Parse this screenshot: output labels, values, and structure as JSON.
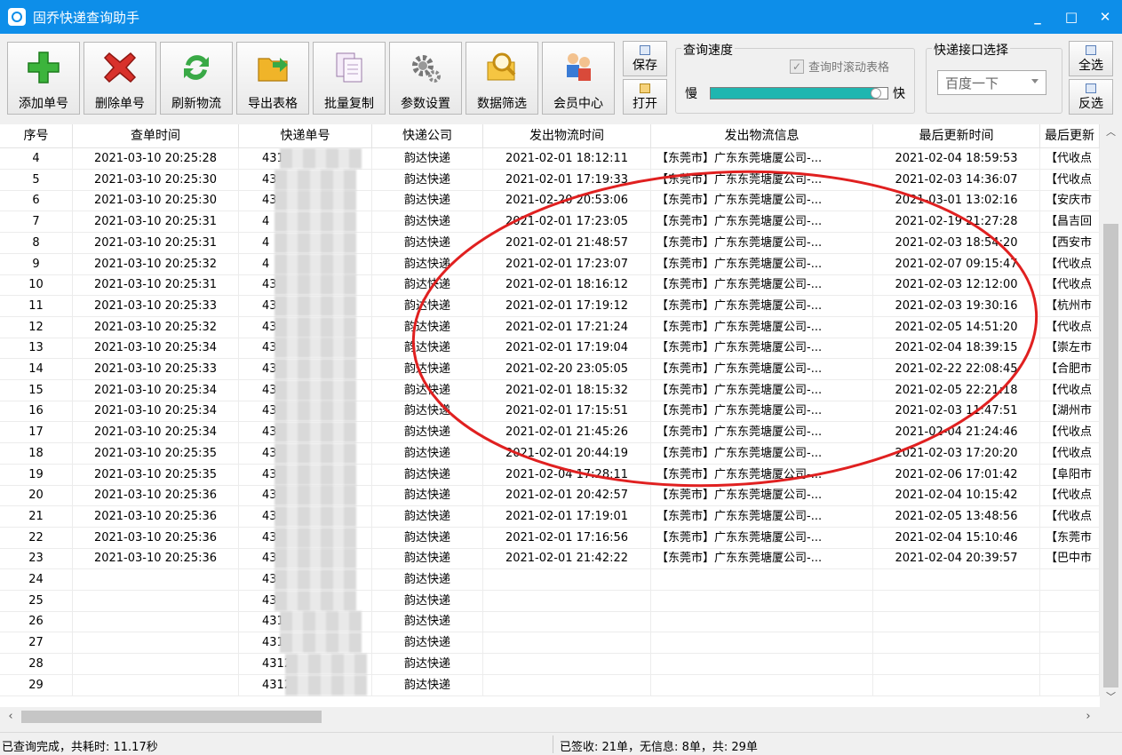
{
  "window": {
    "title": "固乔快递查询助手",
    "minimize": "_",
    "maximize": "□",
    "close": "✕"
  },
  "toolbar": {
    "buttons": [
      {
        "label": "添加单号",
        "icon": "add-icon"
      },
      {
        "label": "删除单号",
        "icon": "delete-icon"
      },
      {
        "label": "刷新物流",
        "icon": "refresh-icon"
      },
      {
        "label": "导出表格",
        "icon": "export-folder-icon"
      },
      {
        "label": "批量复制",
        "icon": "copy-icon"
      },
      {
        "label": "参数设置",
        "icon": "gear-icon"
      },
      {
        "label": "数据筛选",
        "icon": "search-icon"
      },
      {
        "label": "会员中心",
        "icon": "members-icon"
      }
    ],
    "save_label": "保存",
    "open_label": "打开",
    "speed_group_title": "查询速度",
    "scroll_table_label": "查询时滚动表格",
    "slow_label": "慢",
    "fast_label": "快",
    "speed_level": 0.94,
    "api_group_title": "快递接口选择",
    "api_selected": "百度一下",
    "select_all_label": "全选",
    "invert_label": "反选"
  },
  "table": {
    "columns": [
      "序号",
      "查单时间",
      "快递单号",
      "快递公司",
      "发出物流时间",
      "发出物流信息",
      "最后更新时间",
      "最后更新"
    ],
    "rows": [
      [
        "4",
        "2021-03-10 20:25:28",
        "43122",
        "韵达快递",
        "2021-02-01 18:12:11",
        "【东莞市】广东东莞塘厦公司-...",
        "2021-02-04 18:59:53",
        "【代收点"
      ],
      [
        "5",
        "2021-03-10 20:25:30",
        "4312",
        "韵达快递",
        "2021-02-01 17:19:33",
        "【东莞市】广东东莞塘厦公司-...",
        "2021-02-03 14:36:07",
        "【代收点"
      ],
      [
        "6",
        "2021-03-10 20:25:30",
        "43",
        "韵达快递",
        "2021-02-20 20:53:06",
        "【东莞市】广东东莞塘厦公司-...",
        "2021-03-01 13:02:16",
        "【安庆市"
      ],
      [
        "7",
        "2021-03-10 20:25:31",
        "4",
        "韵达快递",
        "2021-02-01 17:23:05",
        "【东莞市】广东东莞塘厦公司-...",
        "2021-02-19 21:27:28",
        "【昌吉回"
      ],
      [
        "8",
        "2021-03-10 20:25:31",
        "4",
        "韵达快递",
        "2021-02-01 21:48:57",
        "【东莞市】广东东莞塘厦公司-...",
        "2021-02-03 18:54:20",
        "【西安市"
      ],
      [
        "9",
        "2021-03-10 20:25:32",
        "4",
        "韵达快递",
        "2021-02-01 17:23:07",
        "【东莞市】广东东莞塘厦公司-...",
        "2021-02-07 09:15:47",
        "【代收点"
      ],
      [
        "10",
        "2021-03-10 20:25:31",
        "43",
        "韵达快递",
        "2021-02-01 18:16:12",
        "【东莞市】广东东莞塘厦公司-...",
        "2021-02-03 12:12:00",
        "【代收点"
      ],
      [
        "11",
        "2021-03-10 20:25:33",
        "43",
        "韵达快递",
        "2021-02-01 17:19:12",
        "【东莞市】广东东莞塘厦公司-...",
        "2021-02-03 19:30:16",
        "【杭州市"
      ],
      [
        "12",
        "2021-03-10 20:25:32",
        "431",
        "韵达快递",
        "2021-02-01 17:21:24",
        "【东莞市】广东东莞塘厦公司-...",
        "2021-02-05 14:51:20",
        "【代收点"
      ],
      [
        "13",
        "2021-03-10 20:25:34",
        "431",
        "韵达快递",
        "2021-02-01 17:19:04",
        "【东莞市】广东东莞塘厦公司-...",
        "2021-02-04 18:39:15",
        "【崇左市"
      ],
      [
        "14",
        "2021-03-10 20:25:33",
        "431",
        "韵达快递",
        "2021-02-20 23:05:05",
        "【东莞市】广东东莞塘厦公司-...",
        "2021-02-22 22:08:45",
        "【合肥市"
      ],
      [
        "15",
        "2021-03-10 20:25:34",
        "431",
        "韵达快递",
        "2021-02-01 18:15:32",
        "【东莞市】广东东莞塘厦公司-...",
        "2021-02-05 22:21:18",
        "【代收点"
      ],
      [
        "16",
        "2021-03-10 20:25:34",
        "431",
        "韵达快递",
        "2021-02-01 17:15:51",
        "【东莞市】广东东莞塘厦公司-...",
        "2021-02-03 11:47:51",
        "【湖州市"
      ],
      [
        "17",
        "2021-03-10 20:25:34",
        "431",
        "韵达快递",
        "2021-02-01 21:45:26",
        "【东莞市】广东东莞塘厦公司-...",
        "2021-02-04 21:24:46",
        "【代收点"
      ],
      [
        "18",
        "2021-03-10 20:25:35",
        "431",
        "韵达快递",
        "2021-02-01 20:44:19",
        "【东莞市】广东东莞塘厦公司-...",
        "2021-02-03 17:20:20",
        "【代收点"
      ],
      [
        "19",
        "2021-03-10 20:25:35",
        "431",
        "韵达快递",
        "2021-02-04 17:28:11",
        "【东莞市】广东东莞塘厦公司-...",
        "2021-02-06 17:01:42",
        "【阜阳市"
      ],
      [
        "20",
        "2021-03-10 20:25:36",
        "4312",
        "韵达快递",
        "2021-02-01 20:42:57",
        "【东莞市】广东东莞塘厦公司-...",
        "2021-02-04 10:15:42",
        "【代收点"
      ],
      [
        "21",
        "2021-03-10 20:25:36",
        "4312",
        "韵达快递",
        "2021-02-01 17:19:01",
        "【东莞市】广东东莞塘厦公司-...",
        "2021-02-05 13:48:56",
        "【代收点"
      ],
      [
        "22",
        "2021-03-10 20:25:36",
        "431",
        "韵达快递",
        "2021-02-01 17:16:56",
        "【东莞市】广东东莞塘厦公司-...",
        "2021-02-04 15:10:46",
        "【东莞市"
      ],
      [
        "23",
        "2021-03-10 20:25:36",
        "431",
        "韵达快递",
        "2021-02-01 21:42:22",
        "【东莞市】广东东莞塘厦公司-...",
        "2021-02-04 20:39:57",
        "【巴中市"
      ],
      [
        "24",
        "",
        "4312",
        "韵达快递",
        "",
        "",
        "",
        ""
      ],
      [
        "25",
        "",
        "4312",
        "韵达快递",
        "",
        "",
        "",
        ""
      ],
      [
        "26",
        "",
        "43122",
        "韵达快递",
        "",
        "",
        "",
        ""
      ],
      [
        "27",
        "",
        "43122",
        "韵达快递",
        "",
        "",
        "",
        ""
      ],
      [
        "28",
        "",
        "431221",
        "韵达快递",
        "",
        "",
        "",
        ""
      ],
      [
        "29",
        "",
        "431222",
        "韵达快递",
        "",
        "",
        "",
        ""
      ]
    ]
  },
  "status": {
    "left": "已查询完成，共耗时: 11.17秒",
    "right": "已签收: 21单，无信息: 8单，共: 29单"
  },
  "colors": {
    "titlebar": "#0d8ee9",
    "slider": "#1fb6b0",
    "annotation": "#e02020"
  }
}
